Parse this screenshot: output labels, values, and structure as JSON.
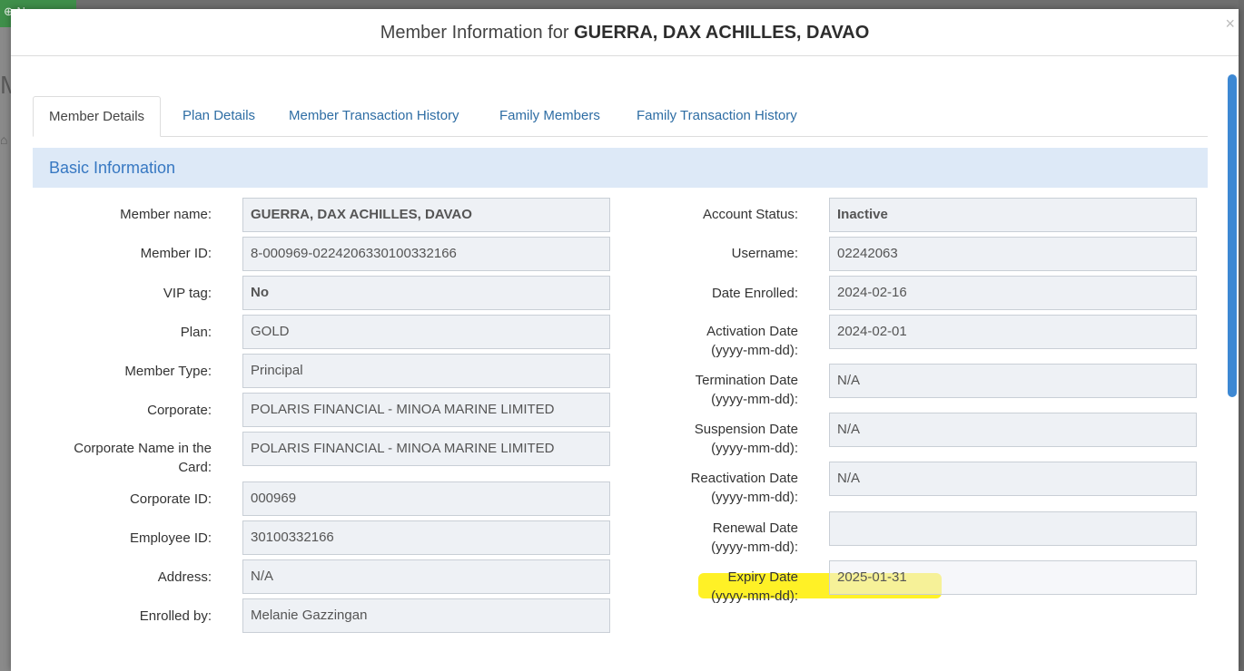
{
  "background": {
    "new_button_label": "⊕ New",
    "left_letter": "M"
  },
  "modal": {
    "title_prefix": "Member Information for ",
    "title_name": "GUERRA, DAX ACHILLES, DAVAO",
    "close_label": "×"
  },
  "tabs": [
    {
      "label": "Member Details",
      "active": true
    },
    {
      "label": "Plan Details"
    },
    {
      "label": "Member Transaction History"
    },
    {
      "label": "Family Members"
    },
    {
      "label": "Family Transaction History"
    }
  ],
  "section": {
    "title": "Basic Information"
  },
  "left_fields": [
    {
      "label": "Member name:",
      "value": "GUERRA, DAX ACHILLES, DAVAO",
      "bold": true
    },
    {
      "label": "Member ID:",
      "value": "8-000969-0224206330100332166"
    },
    {
      "label": "VIP tag:",
      "value": "No",
      "bold": true
    },
    {
      "label": "Plan:",
      "value": "GOLD"
    },
    {
      "label": "Member Type:",
      "value": "Principal"
    },
    {
      "label": "Corporate:",
      "value": "POLARIS FINANCIAL - MINOA MARINE LIMITED"
    },
    {
      "label_line1": "Corporate Name in the",
      "label_line2": "Card:",
      "value": "POLARIS FINANCIAL - MINOA MARINE LIMITED"
    },
    {
      "label": "Corporate ID:",
      "value": "000969"
    },
    {
      "label": "Employee ID:",
      "value": "30100332166"
    },
    {
      "label": "Address:",
      "value": "N/A"
    },
    {
      "label": "Enrolled by:",
      "value": "Melanie Gazzingan"
    }
  ],
  "right_fields": [
    {
      "label": "Account Status:",
      "value": "Inactive",
      "bold": true
    },
    {
      "label": "Username:",
      "value": "02242063"
    },
    {
      "label": "Date Enrolled:",
      "value": "2024-02-16"
    },
    {
      "label_line1": "Activation Date",
      "label_line2": "(yyyy-mm-dd):",
      "value": "2024-02-01"
    },
    {
      "label_line1": "Termination Date",
      "label_line2": "(yyyy-mm-dd):",
      "value": "N/A"
    },
    {
      "label_line1": "Suspension Date",
      "label_line2": "(yyyy-mm-dd):",
      "value": "N/A"
    },
    {
      "label_line1": "Reactivation Date",
      "label_line2": "(yyyy-mm-dd):",
      "value": "N/A"
    },
    {
      "label_line1": "Renewal Date",
      "label_line2": "(yyyy-mm-dd):",
      "value": ""
    },
    {
      "label_line1": "Expiry Date",
      "label_line2": "(yyyy-mm-dd):",
      "value": "2025-01-31"
    }
  ],
  "colors": {
    "accent": "#3778c2",
    "section_bg": "#dde9f7",
    "highlight": "#ffee00"
  }
}
